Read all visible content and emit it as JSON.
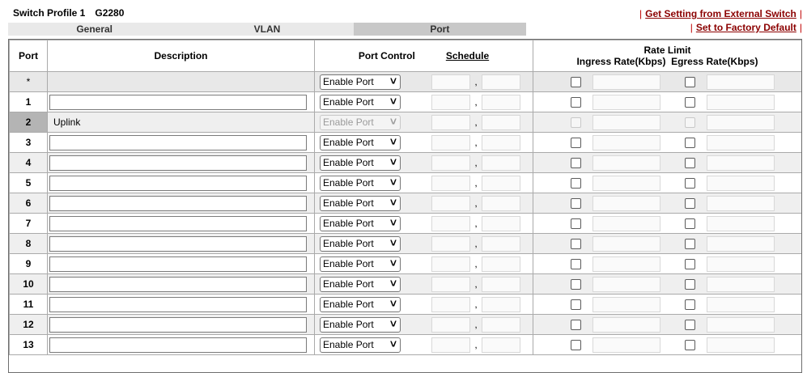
{
  "header": {
    "title": "Switch Profile 1",
    "model": "G2280",
    "get_setting_link": "Get Setting from External Switch",
    "factory_default_link": "Set to Factory Default",
    "separator": "|"
  },
  "tabs": [
    {
      "label": "General",
      "active": false
    },
    {
      "label": "VLAN",
      "active": false
    },
    {
      "label": "Port",
      "active": true
    }
  ],
  "table": {
    "col_port": "Port",
    "col_description": "Description",
    "col_port_control": "Port Control",
    "col_schedule": "Schedule",
    "col_rate_limit": "Rate Limit",
    "col_ingress": "Ingress Rate(Kbps)",
    "col_egress": "Egress Rate(Kbps)",
    "comma": ",",
    "rows": [
      {
        "port": "*",
        "description": "",
        "control": "Enable Port",
        "disabled": false
      },
      {
        "port": "1",
        "description": "",
        "control": "Enable Port",
        "disabled": false
      },
      {
        "port": "2",
        "description": "Uplink",
        "control": "Enable Port",
        "disabled": true
      },
      {
        "port": "3",
        "description": "",
        "control": "Enable Port",
        "disabled": false
      },
      {
        "port": "4",
        "description": "",
        "control": "Enable Port",
        "disabled": false
      },
      {
        "port": "5",
        "description": "",
        "control": "Enable Port",
        "disabled": false
      },
      {
        "port": "6",
        "description": "",
        "control": "Enable Port",
        "disabled": false
      },
      {
        "port": "7",
        "description": "",
        "control": "Enable Port",
        "disabled": false
      },
      {
        "port": "8",
        "description": "",
        "control": "Enable Port",
        "disabled": false
      },
      {
        "port": "9",
        "description": "",
        "control": "Enable Port",
        "disabled": false
      },
      {
        "port": "10",
        "description": "",
        "control": "Enable Port",
        "disabled": false
      },
      {
        "port": "11",
        "description": "",
        "control": "Enable Port",
        "disabled": false
      },
      {
        "port": "12",
        "description": "",
        "control": "Enable Port",
        "disabled": false
      },
      {
        "port": "13",
        "description": "",
        "control": "Enable Port",
        "disabled": false
      }
    ]
  },
  "colors": {
    "link": "#8b0000",
    "separator": "#c00000",
    "active_tab": "#c8c8c8",
    "alt_row": "#efefef"
  },
  "icons": {
    "dropdown": "chevron-down-icon",
    "checkbox": "checkbox-icon"
  }
}
